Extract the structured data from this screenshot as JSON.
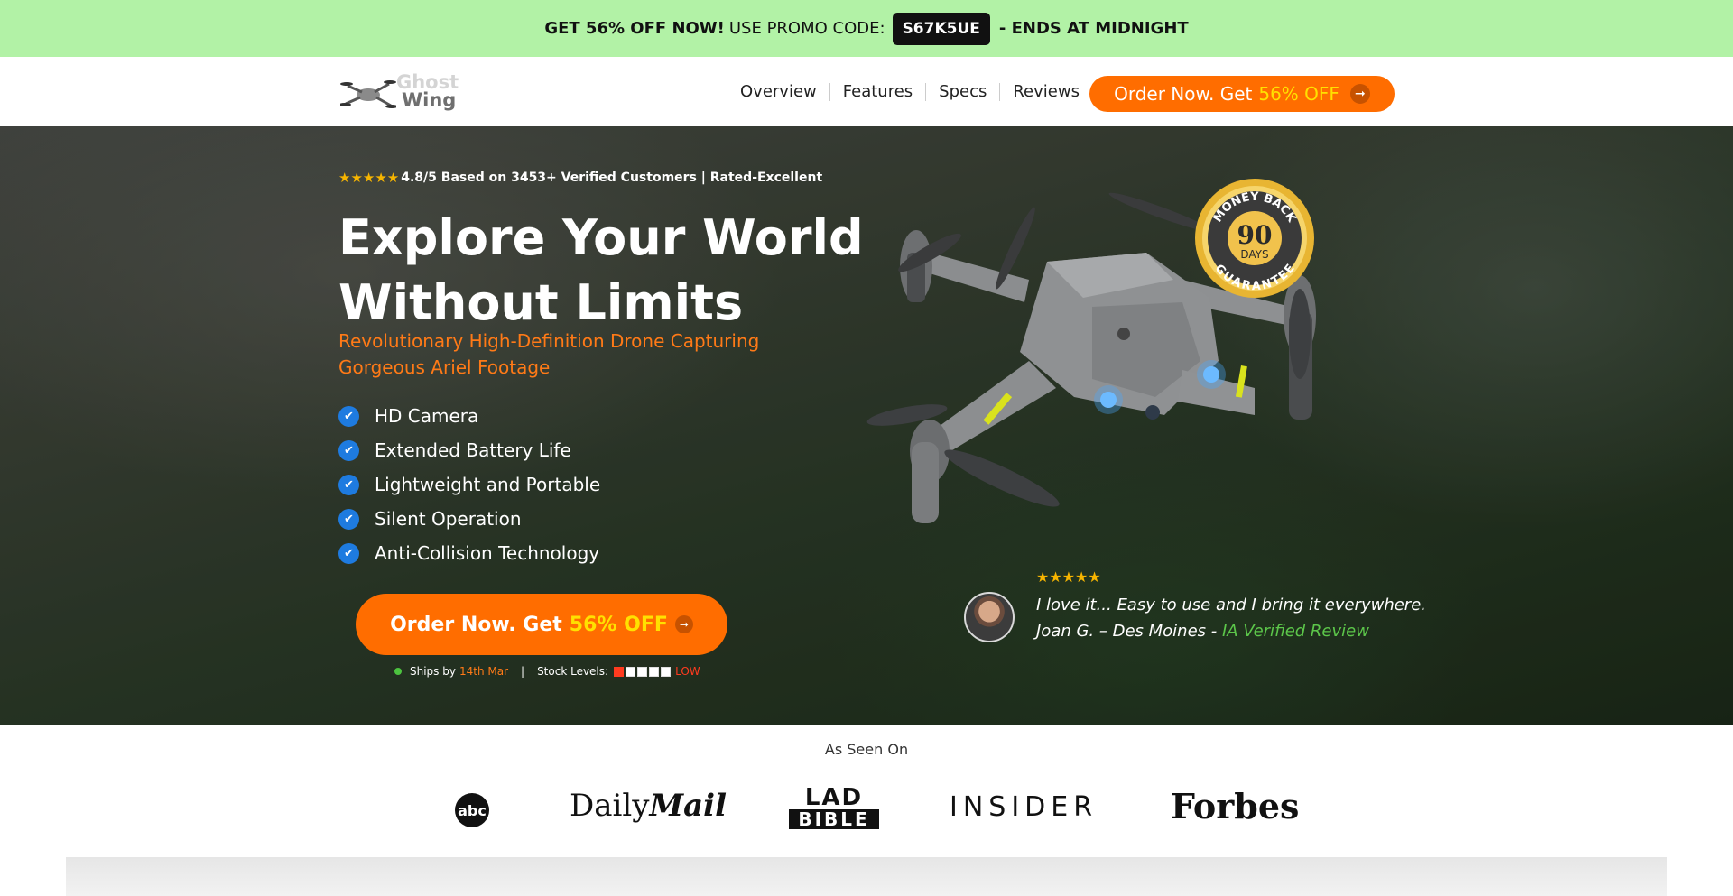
{
  "promo": {
    "lead": "GET 56% OFF NOW!",
    "mid": "USE PROMO CODE:",
    "code": "S67K5UE",
    "tail": "- ENDS AT MIDNIGHT"
  },
  "nav": {
    "logo_line1": "Ghost",
    "logo_line2": "Wing",
    "items": [
      {
        "label": "Overview"
      },
      {
        "label": "Features"
      },
      {
        "label": "Specs"
      },
      {
        "label": "Reviews"
      }
    ],
    "cta_text": "Order Now. Get",
    "cta_highlight": "56% OFF"
  },
  "hero": {
    "rating_text": "4.8/5 Based on 3453+ Verified Customers | Rated-Excellent",
    "title": "Explore Your World Without Limits",
    "subtitle": "Revolutionary High-Definition Drone Capturing Gorgeous Ariel Footage",
    "features": [
      {
        "label": "HD Camera"
      },
      {
        "label": "Extended Battery Life"
      },
      {
        "label": "Lightweight and Portable"
      },
      {
        "label": "Silent Operation"
      },
      {
        "label": "Anti-Collision Technology"
      }
    ],
    "cta_text": "Order Now. Get",
    "cta_highlight": "56% OFF",
    "ships_label": "Ships by",
    "ships_date": "14th Mar",
    "stock_label": "Stock Levels:",
    "stock_level_filled": 1,
    "stock_level_total": 5,
    "stock_status": "LOW",
    "badge_top": "MONEY BACK",
    "badge_number": "90",
    "badge_days": "DAYS",
    "badge_bottom": "GUARANTEE"
  },
  "review": {
    "rating": 5,
    "quote": "I love it... Easy to use and I bring it everywhere.",
    "author": "Joan G. – Des Moines -",
    "verified": "IA Verified Review"
  },
  "seen_on": {
    "title": "As Seen On",
    "logos": {
      "abc": "abc",
      "dm_daily": "Daily",
      "dm_mail": "Mail",
      "lad_top": "LAD",
      "lad_bottom": "BIBLE",
      "insider": "INSIDER",
      "forbes": "Forbes"
    }
  },
  "colors": {
    "promo_bg": "#b2f2a6",
    "accent_orange": "#ff6d00",
    "highlight_yellow": "#ffe100",
    "check_blue": "#1e7be0",
    "verified_green": "#5cc64a",
    "stock_red": "#ff3b1f"
  }
}
